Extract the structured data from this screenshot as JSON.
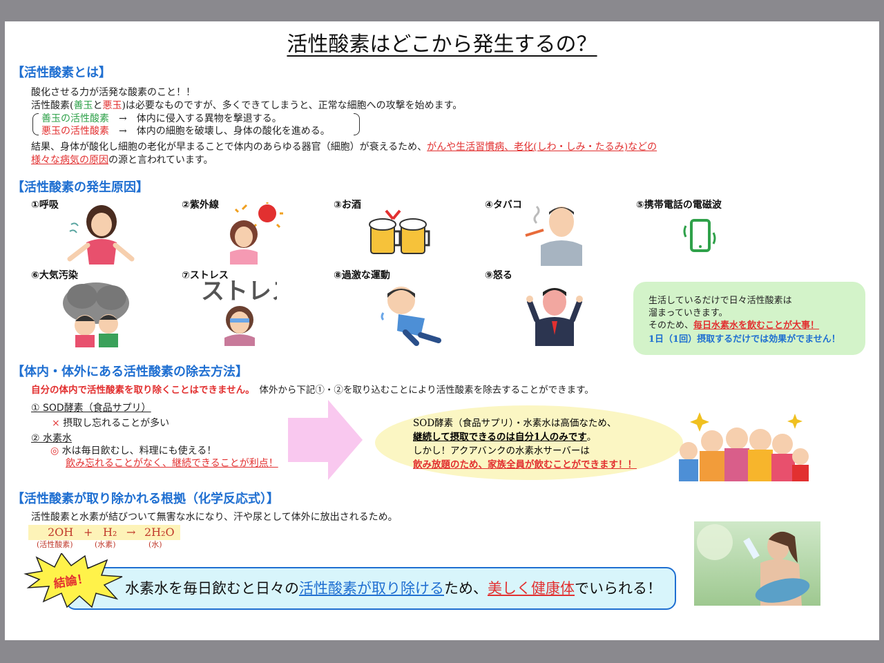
{
  "title": "活性酸素はどこから発生するの？",
  "s1": {
    "heading": "【活性酸素とは】",
    "line1": "酸化させる力が活発な酸素のこと！！",
    "line2_a": "活性酸素(",
    "line2_good": "善玉",
    "line2_and": "と",
    "line2_bad": "悪玉",
    "line2_b": ")は必要なものですが、多くできてしまうと、正常な細胞への攻撃を始めます。",
    "good_label": "善玉の活性酸素",
    "good_desc": "→　体内に侵入する異物を撃退する。",
    "bad_label": "悪玉の活性酸素",
    "bad_desc": "→　体内の細胞を破壊し、身体の酸化を進める。",
    "result_a": "結果、身体が酸化し細胞の老化が早まることで体内のあらゆる器官（細胞）が衰えるため、",
    "result_red": "がんや生活習慣病、老化(しわ・しみ・たるみ)などの",
    "result_red2": "様々な病気の原因",
    "result_b": "の源と言われています。"
  },
  "s2": {
    "heading": "【活性酸素の発生原因】",
    "causes": [
      "①呼吸",
      "②紫外線",
      "③お酒",
      "④タバコ",
      "⑤携帯電話の電磁波",
      "⑥大気汚染",
      "⑦ストレス",
      "⑧過激な運動",
      "⑨怒る"
    ],
    "stress_text": "ストレス",
    "callout": {
      "l1": "生活しているだけで日々活性酸素は",
      "l2": "溜まっていきます。",
      "l3a": "そのため、",
      "l3b": "毎日水素水を飲むことが大事！",
      "l4": "1日（1回）摂取するだけでは効果がでません！"
    }
  },
  "s3": {
    "heading": "【体内・体外にある活性酸素の除去方法】",
    "intro_red": "自分の体内で活性酸素を取り除くことはできません。",
    "intro_b": "体外から下記①・②を取り込むことにより活性酸素を除去することができます。",
    "m1_title": "① SOD酵素（食品サプリ）",
    "m1_mark": "×",
    "m1_desc": "摂取し忘れることが多い",
    "m2_title": "② 水素水",
    "m2_mark": "◎",
    "m2_desc": "水は毎日飲むし、料理にも使える！",
    "m2_red": "飲み忘れることがなく、継続できることが利点！",
    "ellipse": {
      "l1": "SOD酵素（食品サプリ）・水素水は高価なため、",
      "l2": "継続して摂取できるのは自分1人のみです",
      "l2b": "。",
      "l3": "しかし！アクアバンクの水素水サーバーは",
      "l4": "飲み放題のため、家族全員が飲むことができます！！"
    }
  },
  "s4": {
    "heading": "【活性酸素が取り除かれる根拠（化学反応式）】",
    "desc": "活性酸素と水素が結びついて無害な水になり、汗や尿として体外に放出されるため。",
    "eq": [
      "2OH",
      "+",
      "H₂",
      "→",
      "2H₂O"
    ],
    "labels": [
      "(活性酸素)",
      "(水素)",
      "(水)"
    ]
  },
  "conclusion": {
    "badge": "結論！",
    "a": "水素水を毎日飲むと日々の",
    "blue": "活性酸素が取り除ける",
    "b": "ため、",
    "red": "美しく健康体",
    "c": "でいられる！"
  },
  "colors": {
    "heading": "#1f6fd1",
    "good": "#2fa14a",
    "bad": "#e23030",
    "callout": "#d3f3c9",
    "ellipse": "#fbf6c3",
    "arrow": "#f9c8ef"
  }
}
